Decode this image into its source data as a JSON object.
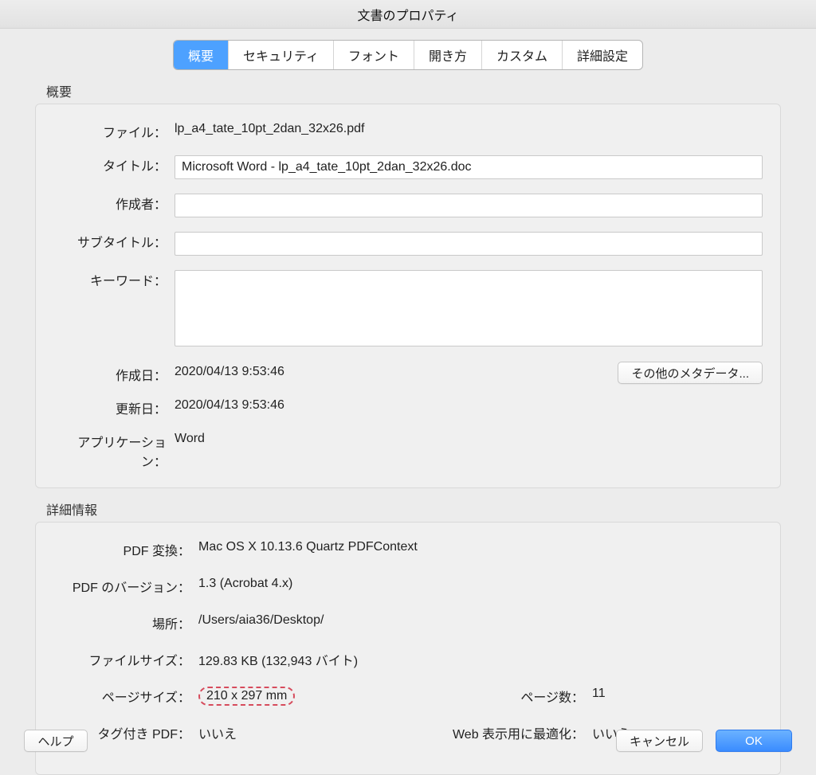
{
  "window": {
    "title": "文書のプロパティ"
  },
  "tabs": {
    "overview": "概要",
    "security": "セキュリティ",
    "fonts": "フォント",
    "open": "開き方",
    "custom": "カスタム",
    "advanced": "詳細設定"
  },
  "overview": {
    "section_title": "概要",
    "file_label": "ファイル：",
    "file_value": "lp_a4_tate_10pt_2dan_32x26.pdf",
    "title_label": "タイトル：",
    "title_value": "Microsoft Word - lp_a4_tate_10pt_2dan_32x26.doc",
    "author_label": "作成者：",
    "author_value": "",
    "subtitle_label": "サブタイトル：",
    "subtitle_value": "",
    "keywords_label": "キーワード：",
    "keywords_value": "",
    "created_label": "作成日：",
    "created_value": "2020/04/13 9:53:46",
    "modified_label": "更新日：",
    "modified_value": "2020/04/13 9:53:46",
    "app_label": "アプリケーション：",
    "app_value": "Word",
    "more_metadata_button": "その他のメタデータ..."
  },
  "details": {
    "section_title": "詳細情報",
    "pdf_producer_label": "PDF 変換：",
    "pdf_producer_value": "Mac OS X 10.13.6 Quartz PDFContext",
    "pdf_version_label": "PDF のバージョン：",
    "pdf_version_value": "1.3 (Acrobat 4.x)",
    "location_label": "場所：",
    "location_value": "/Users/aia36/Desktop/",
    "filesize_label": "ファイルサイズ：",
    "filesize_value": "129.83 KB (132,943 バイト)",
    "pagesize_label": "ページサイズ：",
    "pagesize_value": "210 x 297 mm",
    "pagecount_label": "ページ数：",
    "pagecount_value": "11",
    "tagged_label": "タグ付き PDF：",
    "tagged_value": "いいえ",
    "webopt_label": "Web 表示用に最適化：",
    "webopt_value": "いいえ"
  },
  "footer": {
    "help": "ヘルプ",
    "cancel": "キャンセル",
    "ok": "OK"
  }
}
